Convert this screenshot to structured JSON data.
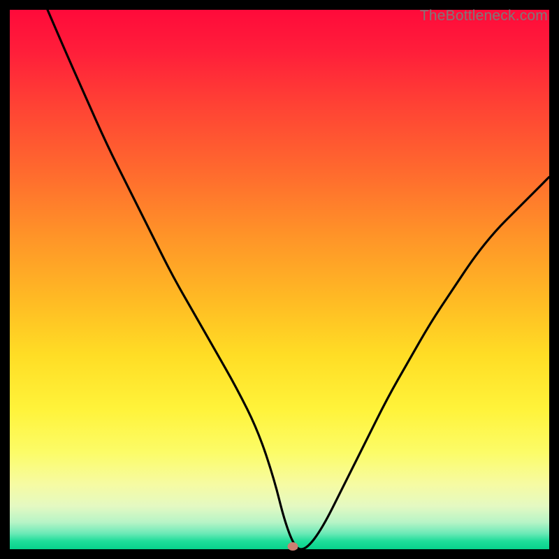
{
  "attribution": "TheBottleneck.com",
  "marker": {
    "x_pct": 52.5,
    "y_pct": 99.5,
    "color": "#cb7f72"
  },
  "chart_data": {
    "type": "line",
    "title": "",
    "xlabel": "",
    "ylabel": "",
    "xlim": [
      0,
      100
    ],
    "ylim": [
      0,
      100
    ],
    "grid": false,
    "legend": false,
    "series": [
      {
        "name": "bottleneck-curve",
        "x": [
          7,
          10,
          14,
          18,
          22,
          26,
          30,
          34,
          38,
          42,
          46,
          49,
          51,
          53,
          55,
          58,
          62,
          66,
          70,
          74,
          78,
          82,
          86,
          90,
          94,
          98,
          100
        ],
        "y": [
          100,
          93,
          84,
          75,
          67,
          59,
          51,
          44,
          37,
          30,
          22,
          13,
          5,
          0,
          0,
          4,
          12,
          20,
          28,
          35,
          42,
          48,
          54,
          59,
          63,
          67,
          69
        ]
      }
    ],
    "annotations": [
      {
        "type": "point",
        "name": "optimal-point",
        "x": 52.5,
        "y": 0
      }
    ],
    "background_gradient": {
      "direction": "vertical",
      "stops": [
        {
          "pct": 0,
          "color": "#ff0a3a"
        },
        {
          "pct": 50,
          "color": "#ffbb24"
        },
        {
          "pct": 80,
          "color": "#fcfc67"
        },
        {
          "pct": 100,
          "color": "#06d28b"
        }
      ]
    }
  }
}
